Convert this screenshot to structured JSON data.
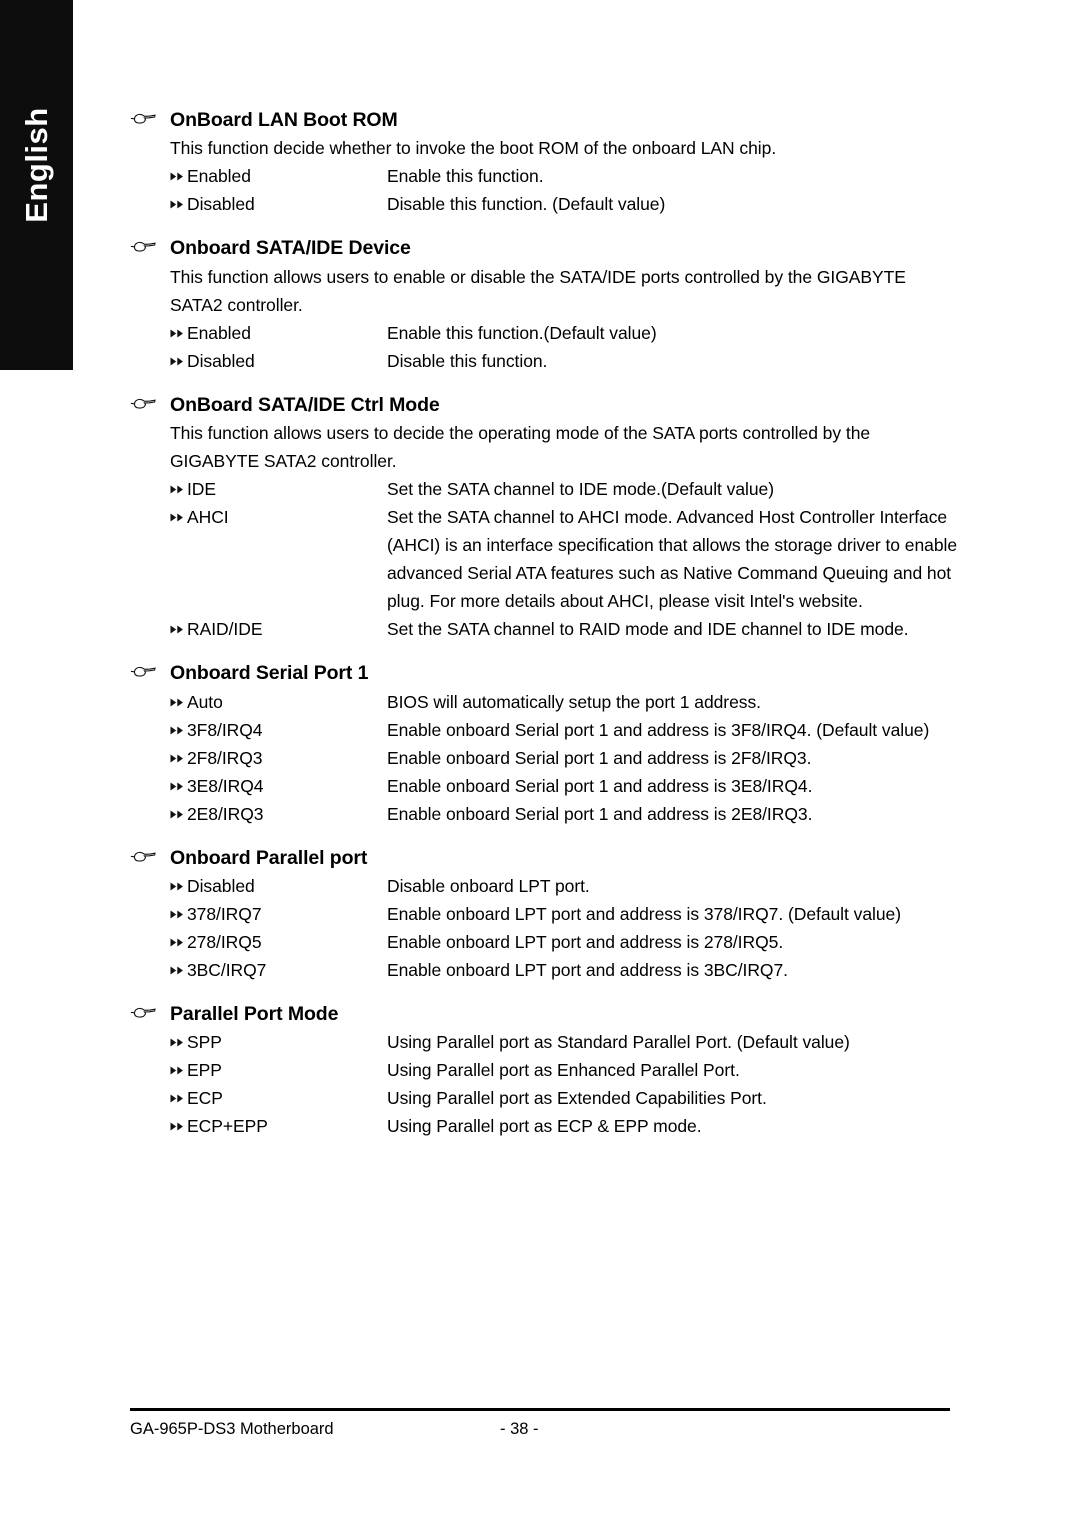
{
  "page": {
    "language_tab": "English"
  },
  "icons": {
    "heading_bullet": "pointing-hand-icon",
    "option_bullet": "double-triangle-right-icon"
  },
  "sections": [
    {
      "title": "OnBoard LAN Boot ROM",
      "description": "This function decide whether to invoke the boot ROM of the onboard LAN chip.",
      "options": [
        {
          "label": "Enabled",
          "desc": "Enable this function."
        },
        {
          "label": "Disabled",
          "desc": "Disable this function. (Default value)"
        }
      ]
    },
    {
      "title": "Onboard SATA/IDE Device",
      "description": "This function allows users to enable or disable the SATA/IDE ports controlled by the GIGABYTE SATA2 controller.",
      "options": [
        {
          "label": "Enabled",
          "desc": "Enable this function.(Default value)"
        },
        {
          "label": "Disabled",
          "desc": "Disable this function."
        }
      ]
    },
    {
      "title": "OnBoard SATA/IDE Ctrl Mode",
      "description": "This function allows users to decide the operating mode of the SATA ports controlled by the GIGABYTE SATA2 controller.",
      "options": [
        {
          "label": "IDE",
          "desc": "Set the SATA channel to IDE mode.(Default value)"
        },
        {
          "label": "AHCI",
          "desc": "Set the SATA channel to AHCI mode. Advanced Host Controller Interface (AHCI) is an interface specification that allows the storage driver to enable advanced Serial ATA features such as Native Command Queuing and hot plug. For more details about AHCI, please visit Intel's website."
        },
        {
          "label": "RAID/IDE",
          "desc": "Set the SATA channel to RAID mode and IDE channel to IDE mode."
        }
      ]
    },
    {
      "title": "Onboard Serial Port 1",
      "description": "",
      "options": [
        {
          "label": "Auto",
          "desc": "BIOS will automatically setup the port 1 address."
        },
        {
          "label": "3F8/IRQ4",
          "desc": "Enable onboard Serial port 1 and address is 3F8/IRQ4. (Default value)"
        },
        {
          "label": "2F8/IRQ3",
          "desc": "Enable onboard Serial port 1 and address is 2F8/IRQ3."
        },
        {
          "label": "3E8/IRQ4",
          "desc": "Enable onboard Serial port 1 and address is 3E8/IRQ4."
        },
        {
          "label": "2E8/IRQ3",
          "desc": "Enable onboard Serial port 1 and address is 2E8/IRQ3."
        }
      ]
    },
    {
      "title": "Onboard Parallel port",
      "description": "",
      "options": [
        {
          "label": "Disabled",
          "desc": "Disable onboard LPT port."
        },
        {
          "label": "378/IRQ7",
          "desc": "Enable onboard LPT port and address is 378/IRQ7. (Default value)"
        },
        {
          "label": "278/IRQ5",
          "desc": "Enable onboard LPT port and address is 278/IRQ5."
        },
        {
          "label": "3BC/IRQ7",
          "desc": "Enable onboard LPT port and address is 3BC/IRQ7."
        }
      ]
    },
    {
      "title": "Parallel Port Mode",
      "description": "",
      "options": [
        {
          "label": "SPP",
          "desc": "Using Parallel port as Standard Parallel Port. (Default value)"
        },
        {
          "label": "EPP",
          "desc": "Using Parallel port as Enhanced Parallel Port."
        },
        {
          "label": "ECP",
          "desc": "Using Parallel port as Extended Capabilities Port."
        },
        {
          "label": "ECP+EPP",
          "desc": "Using Parallel port as ECP & EPP mode."
        }
      ]
    }
  ],
  "footer": {
    "product": "GA-965P-DS3 Motherboard",
    "page_number": "- 38 -"
  }
}
